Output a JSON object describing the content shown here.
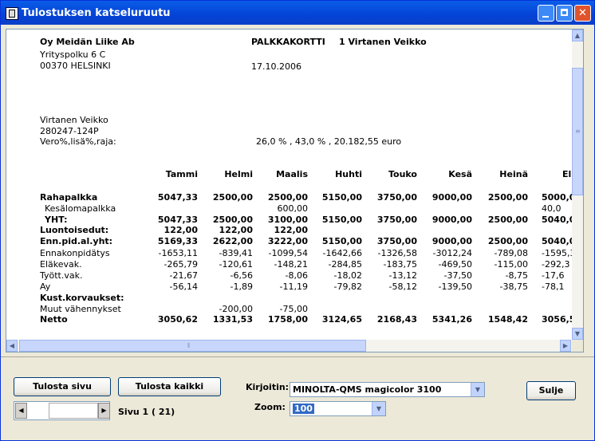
{
  "window": {
    "title": "Tulostuksen katseluruutu"
  },
  "document": {
    "company": [
      "Oy Meidän Liike Ab",
      "Yrityspolku 6 C",
      "00370 HELSINKI"
    ],
    "card_title": "PALKKAKORTTI",
    "employee_ref": "1 Virtanen Veikko",
    "date": "17.10.2006",
    "employee": [
      "Virtanen Veikko",
      "280247-124P",
      "Vero%,lisä%,raja:"
    ],
    "tax_info": "26,0 % ,  43,0 % , 20.182,55 euro",
    "months": [
      "Tammi",
      "Helmi",
      "Maalis",
      "Huhti",
      "Touko",
      "Kesä",
      "Heinä",
      "El"
    ],
    "rows": [
      {
        "label": "Rahapalkka",
        "bold": true,
        "values": [
          "5047,33",
          "2500,00",
          "2500,00",
          "5150,00",
          "3750,00",
          "9000,00",
          "2500,00",
          "5000,0"
        ]
      },
      {
        "label": "Kesälomapalkka",
        "bold": false,
        "indent": true,
        "values": [
          "",
          "",
          "600,00",
          "",
          "",
          "",
          "",
          "40,0"
        ]
      },
      {
        "label": "YHT:",
        "bold": true,
        "indent": true,
        "values": [
          "5047,33",
          "2500,00",
          "3100,00",
          "5150,00",
          "3750,00",
          "9000,00",
          "2500,00",
          "5040,0"
        ]
      },
      {
        "label": "Luontoisedut:",
        "bold": true,
        "values": [
          "122,00",
          "122,00",
          "122,00",
          "",
          "",
          "",
          "",
          ""
        ]
      },
      {
        "label": "Enn.pid.al.yht:",
        "bold": true,
        "values": [
          "5169,33",
          "2622,00",
          "3222,00",
          "5150,00",
          "3750,00",
          "9000,00",
          "2500,00",
          "5040,0"
        ]
      },
      {
        "label": "Ennakonpidätys",
        "bold": false,
        "values": [
          "-1653,11",
          "-839,41",
          "-1099,54",
          "-1642,66",
          "-1326,58",
          "-3012,24",
          "-789,08",
          "-1595,3"
        ]
      },
      {
        "label": "Eläkevak.",
        "bold": false,
        "values": [
          "-265,79",
          "-120,61",
          "-148,21",
          "-284,85",
          "-183,75",
          "-469,50",
          "-115,00",
          "-292,3"
        ]
      },
      {
        "label": "Tyött.vak.",
        "bold": false,
        "values": [
          "-21,67",
          "-6,56",
          "-8,06",
          "-18,02",
          "-13,12",
          "-37,50",
          "-8,75",
          "-17,6"
        ]
      },
      {
        "label": "Ay",
        "bold": false,
        "values": [
          "-56,14",
          "-1,89",
          "-11,19",
          "-79,82",
          "-58,12",
          "-139,50",
          "-38,75",
          "-78,1"
        ]
      },
      {
        "label": "Kust.korvaukset:",
        "bold": true,
        "values": [
          "",
          "",
          "",
          "",
          "",
          "",
          "",
          ""
        ]
      },
      {
        "label": "Muut vähennykset",
        "bold": false,
        "values": [
          "",
          "-200,00",
          "-75,00",
          "",
          "",
          "",
          "",
          ""
        ]
      },
      {
        "label": "Netto",
        "bold": true,
        "values": [
          "3050,62",
          "1331,53",
          "1758,00",
          "3124,65",
          "2168,43",
          "5341,26",
          "1548,42",
          "3056,5"
        ]
      }
    ]
  },
  "controls": {
    "print_page": "Tulosta sivu",
    "print_all": "Tulosta kaikki",
    "page_label": "Sivu  1 ( 21)",
    "printer_label": "Kirjoitin:",
    "printer_value": "MINOLTA-QMS magicolor 3100",
    "zoom_label": "Zoom:",
    "zoom_value": "100",
    "close": "Sulje"
  },
  "colors": {
    "titlebar": "#0a5de8",
    "window_bg": "#ece9d8",
    "close_button": "#e0542c"
  }
}
